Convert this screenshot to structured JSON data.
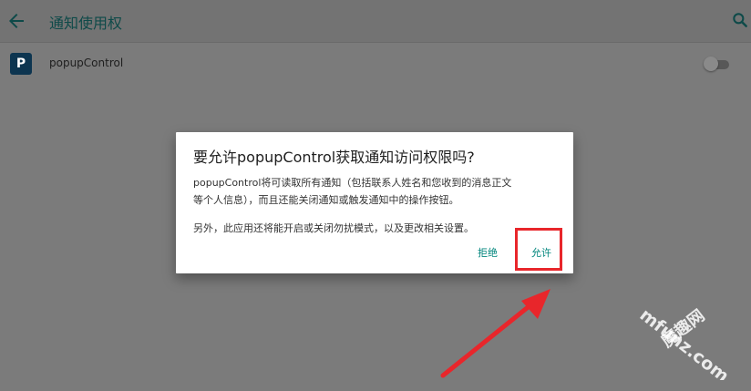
{
  "appbar": {
    "title": "通知使用权"
  },
  "list": {
    "items": [
      {
        "label": "popupControl",
        "icon_letter": "P",
        "enabled": false
      }
    ]
  },
  "dialog": {
    "title": "要允许popupControl获取通知访问权限吗?",
    "message_line1": "popupControl将可读取所有通知（包括联系人姓名和您收到的消息正文",
    "message_line2": "等个人信息），而且还能关闭通知或触发通知中的操作按钮。",
    "message2": "另外，此应用还将能开启或关闭勿扰模式，以及更改相关设置。",
    "deny_label": "拒绝",
    "allow_label": "允许"
  },
  "watermark": {
    "cn": "魔趣网",
    "en": "mfunz.com"
  },
  "colors": {
    "accent": "#00857c",
    "annotation": "#e8262b",
    "scrim": "#7b7b7b"
  },
  "icons": [
    "back-arrow-icon",
    "search-icon",
    "app-icon"
  ]
}
